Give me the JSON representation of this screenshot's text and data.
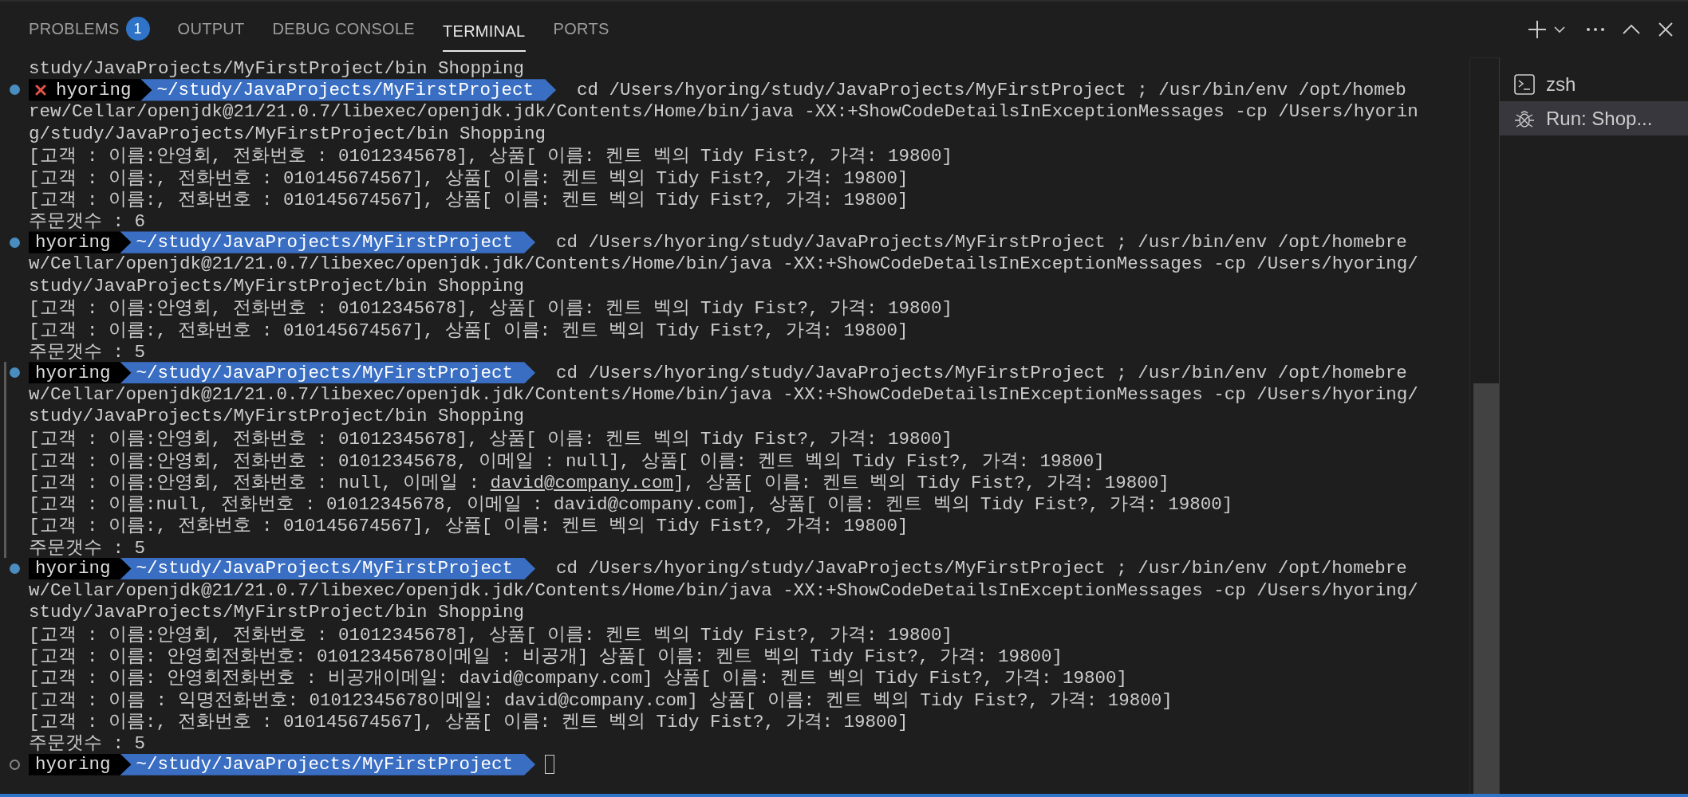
{
  "panel_tabs": [
    {
      "label": "PROBLEMS",
      "selected": false,
      "badge": "1"
    },
    {
      "label": "OUTPUT",
      "selected": false
    },
    {
      "label": "DEBUG CONSOLE",
      "selected": false
    },
    {
      "label": "TERMINAL",
      "selected": true
    },
    {
      "label": "PORTS",
      "selected": false
    }
  ],
  "terminal": {
    "leading_lines": [
      "study/JavaProjects/MyFirstProject/bin Shopping"
    ],
    "commands": [
      {
        "done": true,
        "failed": true,
        "hovered": false,
        "user": "hyoring",
        "path": "~/study/JavaProjects/MyFirstProject",
        "command_lines": [
          "cd /Users/hyoring/study/JavaProjects/MyFirstProject ; /usr/bin/env /opt/homeb",
          "rew/Cellar/openjdk@21/21.0.7/libexec/openjdk.jdk/Contents/Home/bin/java -XX:+ShowCodeDetailsInExceptionMessages -cp /Users/hyorin",
          "g/study/JavaProjects/MyFirstProject/bin Shopping"
        ],
        "output": [
          {
            "kind": "plain",
            "text": "[고객 : 이름:안영회, 전화번호 : 01012345678], 상품[ 이름: 켄트 벡의 Tidy Fist?, 가격: 19800]"
          },
          {
            "kind": "plain",
            "text": "[고객 : 이름:, 전화번호 : 010145674567], 상품[ 이름: 켄트 벡의 Tidy Fist?, 가격: 19800]"
          },
          {
            "kind": "plain",
            "text": "[고객 : 이름:, 전화번호 : 010145674567], 상품[ 이름: 켄트 벡의 Tidy Fist?, 가격: 19800]"
          },
          {
            "kind": "plain",
            "text": "주문갯수 : 6"
          }
        ]
      },
      {
        "done": true,
        "failed": false,
        "hovered": false,
        "user": "hyoring",
        "path": "~/study/JavaProjects/MyFirstProject",
        "command_lines": [
          "cd /Users/hyoring/study/JavaProjects/MyFirstProject ; /usr/bin/env /opt/homebre",
          "w/Cellar/openjdk@21/21.0.7/libexec/openjdk.jdk/Contents/Home/bin/java -XX:+ShowCodeDetailsInExceptionMessages -cp /Users/hyoring/",
          "study/JavaProjects/MyFirstProject/bin Shopping"
        ],
        "output": [
          {
            "kind": "plain",
            "text": "[고객 : 이름:안영회, 전화번호 : 01012345678], 상품[ 이름: 켄트 벡의 Tidy Fist?, 가격: 19800]"
          },
          {
            "kind": "plain",
            "text": "[고객 : 이름:, 전화번호 : 010145674567], 상품[ 이름: 켄트 벡의 Tidy Fist?, 가격: 19800]"
          },
          {
            "kind": "plain",
            "text": "주문갯수 : 5"
          }
        ]
      },
      {
        "done": true,
        "failed": false,
        "hovered": true,
        "user": "hyoring",
        "path": "~/study/JavaProjects/MyFirstProject",
        "command_lines": [
          "cd /Users/hyoring/study/JavaProjects/MyFirstProject ; /usr/bin/env /opt/homebre",
          "w/Cellar/openjdk@21/21.0.7/libexec/openjdk.jdk/Contents/Home/bin/java -XX:+ShowCodeDetailsInExceptionMessages -cp /Users/hyoring/",
          "study/JavaProjects/MyFirstProject/bin Shopping"
        ],
        "output": [
          {
            "kind": "plain",
            "text": "[고객 : 이름:안영회, 전화번호 : 01012345678], 상품[ 이름: 켄트 벡의 Tidy Fist?, 가격: 19800]"
          },
          {
            "kind": "plain",
            "text": "[고객 : 이름:안영회, 전화번호 : 01012345678, 이메일 : null], 상품[ 이름: 켄트 벡의 Tidy Fist?, 가격: 19800]"
          },
          {
            "kind": "link",
            "before": "[고객 : 이름:안영회, 전화번호 : null, 이메일 : ",
            "link": "david@company.com",
            "after": "], 상품[ 이름: 켄트 벡의 Tidy Fist?, 가격: 19800]"
          },
          {
            "kind": "plain",
            "text": "[고객 : 이름:null, 전화번호 : 01012345678, 이메일 : david@company.com], 상품[ 이름: 켄트 벡의 Tidy Fist?, 가격: 19800]"
          },
          {
            "kind": "plain",
            "text": "[고객 : 이름:, 전화번호 : 010145674567], 상품[ 이름: 켄트 벡의 Tidy Fist?, 가격: 19800]"
          },
          {
            "kind": "plain",
            "text": "주문갯수 : 5"
          }
        ]
      },
      {
        "done": true,
        "failed": false,
        "hovered": false,
        "user": "hyoring",
        "path": "~/study/JavaProjects/MyFirstProject",
        "command_lines": [
          "cd /Users/hyoring/study/JavaProjects/MyFirstProject ; /usr/bin/env /opt/homebre",
          "w/Cellar/openjdk@21/21.0.7/libexec/openjdk.jdk/Contents/Home/bin/java -XX:+ShowCodeDetailsInExceptionMessages -cp /Users/hyoring/",
          "study/JavaProjects/MyFirstProject/bin Shopping"
        ],
        "output": [
          {
            "kind": "plain",
            "text": "[고객 : 이름:안영회, 전화번호 : 01012345678], 상품[ 이름: 켄트 벡의 Tidy Fist?, 가격: 19800]"
          },
          {
            "kind": "plain",
            "text": "[고객 : 이름: 안영회전화번호: 01012345678이메일 : 비공개] 상품[ 이름: 켄트 벡의 Tidy Fist?, 가격: 19800]"
          },
          {
            "kind": "plain",
            "text": "[고객 : 이름: 안영회전화번호 : 비공개이메일: david@company.com] 상품[ 이름: 켄트 벡의 Tidy Fist?, 가격: 19800]"
          },
          {
            "kind": "plain",
            "text": "[고객 : 이름 : 익명전화번호: 01012345678이메일: david@company.com] 상품[ 이름: 켄트 벡의 Tidy Fist?, 가격: 19800]"
          },
          {
            "kind": "plain",
            "text": "[고객 : 이름:, 전화번호 : 010145674567], 상품[ 이름: 켄트 벡의 Tidy Fist?, 가격: 19800]"
          },
          {
            "kind": "plain",
            "text": "주문갯수 : 5"
          }
        ]
      },
      {
        "done": false,
        "failed": false,
        "hovered": false,
        "user": "hyoring",
        "path": "~/study/JavaProjects/MyFirstProject"
      }
    ]
  },
  "terminal_list": [
    {
      "kind": "shell",
      "label": "zsh",
      "selected": false
    },
    {
      "kind": "debug",
      "label": "Run: Shop...",
      "selected": true
    }
  ]
}
